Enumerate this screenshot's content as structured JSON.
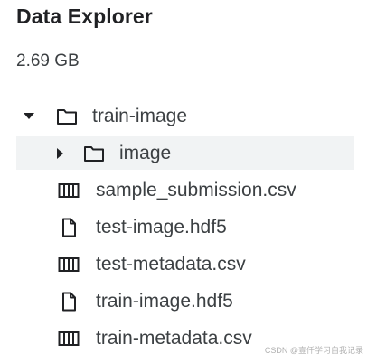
{
  "header": {
    "title": "Data Explorer",
    "size": "2.69 GB"
  },
  "tree": {
    "folder_root": {
      "label": "train-image",
      "expanded": true,
      "icon": "folder-icon"
    },
    "folder_child": {
      "label": "image",
      "expanded": false,
      "icon": "folder-icon"
    },
    "files": [
      {
        "label": "sample_submission.csv",
        "icon": "table-icon"
      },
      {
        "label": "test-image.hdf5",
        "icon": "file-icon"
      },
      {
        "label": "test-metadata.csv",
        "icon": "table-icon"
      },
      {
        "label": "train-image.hdf5",
        "icon": "file-icon"
      },
      {
        "label": "train-metadata.csv",
        "icon": "table-icon"
      }
    ]
  },
  "footer": {
    "watermark": "CSDN @壹仟学习自我记录"
  }
}
